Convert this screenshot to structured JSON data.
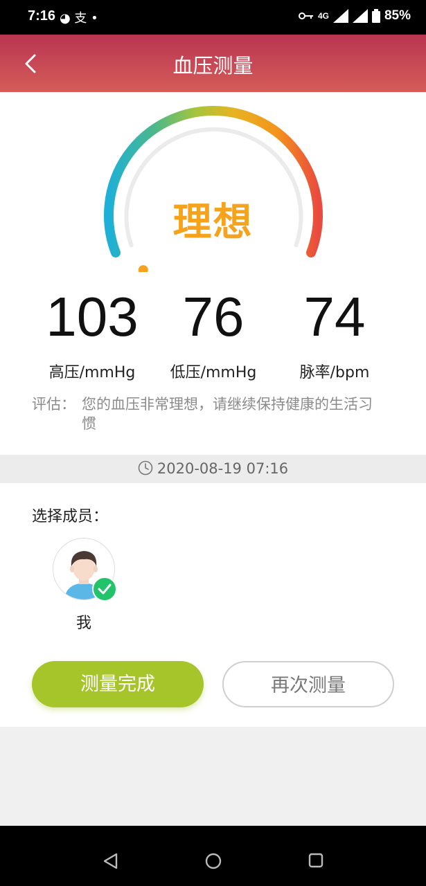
{
  "status_bar": {
    "time": "7:16",
    "left_icons": "◕ 支 •",
    "network": "4G",
    "battery": "85%"
  },
  "header": {
    "title": "血压测量"
  },
  "gauge": {
    "status": "理想",
    "level": 0.08
  },
  "metrics": [
    {
      "value": "103",
      "unit": "高压/mmHg"
    },
    {
      "value": "76",
      "unit": "低压/mmHg"
    },
    {
      "value": "74",
      "unit": "脉率/bpm"
    }
  ],
  "assessment": {
    "label": "评估：",
    "text": "您的血压非常理想，请继续保持健康的生活习惯"
  },
  "timestamp": "2020-08-19 07:16",
  "members": {
    "title": "选择成员：",
    "items": [
      {
        "name": "我",
        "selected": true
      }
    ]
  },
  "actions": {
    "done": "测量完成",
    "again": "再次测量"
  },
  "colors": {
    "header_top": "#b93552",
    "header_bottom": "#d45c58",
    "accent": "#f5a21c",
    "done_button": "#a5c52a",
    "check": "#22c36a"
  }
}
